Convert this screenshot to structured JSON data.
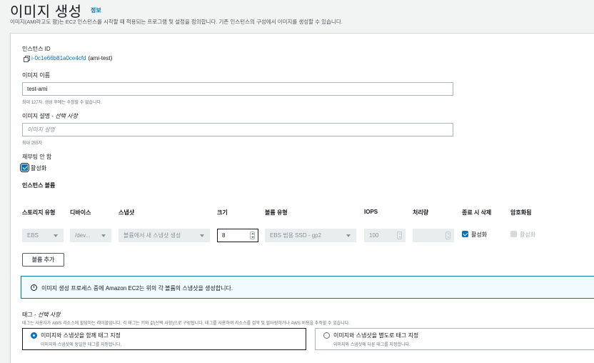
{
  "page": {
    "title": "이미지 생성",
    "info_link": "정보",
    "description": "이미지(AMI라고도 함)는 EC2 인스턴스를 시작할 때 적용되는 프로그램 및 설정을 정의합니다. 기존 인스턴스의 구성에서 이미지를 생성할 수 있습니다."
  },
  "instance": {
    "label": "인스턴스 ID",
    "id": "i-0c1e66b81a0ce4cfd",
    "name_suffix": "(ami-test)"
  },
  "image_name": {
    "label": "이미지 이름",
    "value": "test-ami",
    "hint": "최대 127자. 생성 후에는 수정할 수 없습니다."
  },
  "image_description": {
    "label": "이미지 설명",
    "optional": "선택 사항",
    "separator": " - ",
    "placeholder": "이미지 설명",
    "hint": "최대 255자"
  },
  "no_reboot": {
    "label": "재부팅 안 함",
    "checkbox_label": "활성화",
    "checked": true
  },
  "volumes": {
    "section_label": "인스턴스 볼륨",
    "headers": {
      "storage_type": "스토리지 유형",
      "device": "디바이스",
      "snapshot": "스냅샷",
      "size": "크기",
      "volume_type": "볼륨 유형",
      "iops": "IOPS",
      "throughput": "처리량",
      "delete_on_termination": "종료 시 삭제",
      "encrypted": "암호화됨"
    },
    "row": {
      "storage_type": "EBS",
      "device": "/dev...",
      "snapshot": "볼륨에서 새 스냅샷 생성",
      "size": "8",
      "volume_type": "EBS 범용 SSD - gp2",
      "iops": "100",
      "throughput": "",
      "delete_on_termination_label": "활성화",
      "encrypted_label": "활성화"
    },
    "add_button": "볼륨 추가"
  },
  "notice": {
    "text": "이미지 생성 프로세스 중에 Amazon EC2는 위의 각 볼륨의 스냅샷을 생성합니다."
  },
  "tags": {
    "label": "태그",
    "optional": "선택 사항",
    "separator": " - ",
    "description": "태그는 사용자가 AWS 리소스에 할당하는 레이블입니다. 각 태그는 키와 값(선택 사항)으로 구성됩니다. 태그를 사용하여 리소스를 검색 및 필터링하거나 AWS 비용을 추적할 수 있습니다.",
    "options": [
      {
        "title": "이미지와 스냅샷을 함께 태그 지정",
        "desc": "이미지와 스냅샷에 동일한 태그를 지정합니다."
      },
      {
        "title": "이미지와 스냅샷을 별도로 태그 지정",
        "desc": "이미지와 스냅샷에 다른 태그를 지정합니다."
      }
    ]
  },
  "colors": {
    "link": "#0073bb",
    "text": "#16191f",
    "muted": "#687078",
    "info_bg": "#f1faff"
  },
  "icons": {
    "copy": "copy-icon",
    "info": "info-circle-icon",
    "caret": "caret-down-icon"
  }
}
